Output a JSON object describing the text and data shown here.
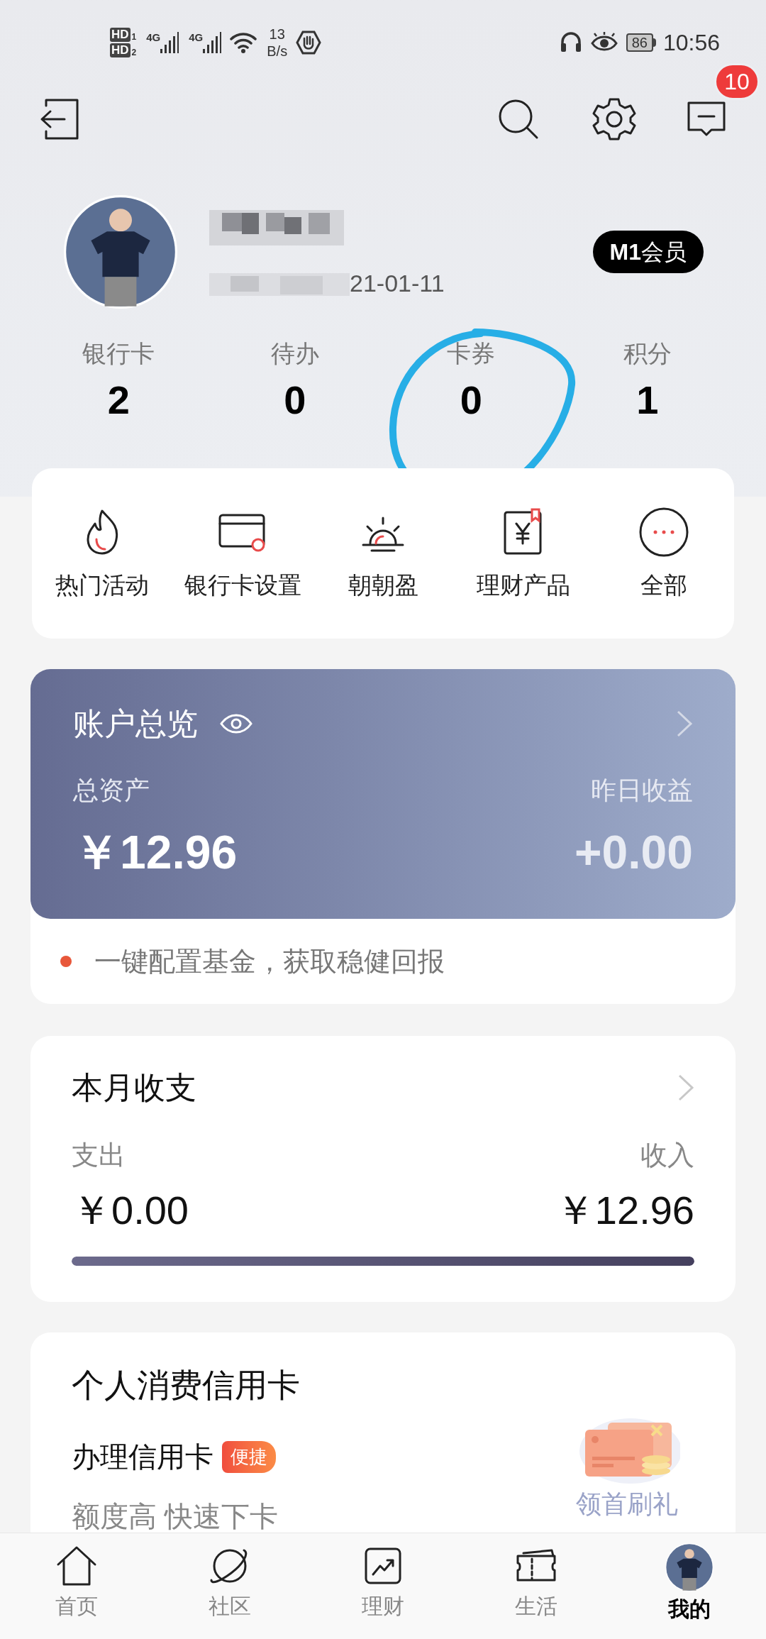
{
  "status_bar": {
    "sims": [
      {
        "label": "HD",
        "slot": "1"
      },
      {
        "label": "HD",
        "slot": "2"
      }
    ],
    "networks": [
      "4G",
      "4G"
    ],
    "speed_value": "13",
    "speed_unit": "B/s",
    "battery": "86",
    "time": "10:56"
  },
  "header": {
    "message_badge": "10"
  },
  "profile": {
    "date_visible": "21-01-11",
    "membership": "**M1**会员"
  },
  "stats": [
    {
      "label": "银行卡",
      "value": "2"
    },
    {
      "label": "待办",
      "value": "0"
    },
    {
      "label": "卡券",
      "value": "0"
    },
    {
      "label": "积分",
      "value": "1"
    }
  ],
  "shortcuts": [
    {
      "label": "热门活动",
      "kind": "flame"
    },
    {
      "label": "银行卡设置",
      "kind": "card"
    },
    {
      "label": "朝朝盈",
      "kind": "sunrise"
    },
    {
      "label": "理财产品",
      "kind": "finance"
    },
    {
      "label": "全部",
      "kind": "more"
    }
  ],
  "account_overview": {
    "title": "账户总览",
    "total_label": "总资产",
    "total_value": "￥12.96",
    "yesterday_label": "昨日收益",
    "yesterday_value": "+0.00",
    "tip": "一键配置基金，获取稳健回报"
  },
  "monthly": {
    "title": "本月收支",
    "expense_label": "支出",
    "expense_value": "￥0.00",
    "income_label": "收入",
    "income_value": "￥12.96",
    "level": 1
  },
  "credit_card": {
    "title": "个人消费信用卡",
    "item": "办理信用卡",
    "tag": "便捷",
    "subtitle": "额度高 快速下卡",
    "promo": "领首刷礼"
  },
  "bottom_nav": [
    {
      "label": "首页",
      "kind": "home",
      "selected": false
    },
    {
      "label": "社区",
      "kind": "planet",
      "selected": false
    },
    {
      "label": "理财",
      "kind": "chart",
      "selected": false
    },
    {
      "label": "生活",
      "kind": "ticket",
      "selected": false
    },
    {
      "label": "我的",
      "kind": "avatar",
      "selected": true
    }
  ]
}
